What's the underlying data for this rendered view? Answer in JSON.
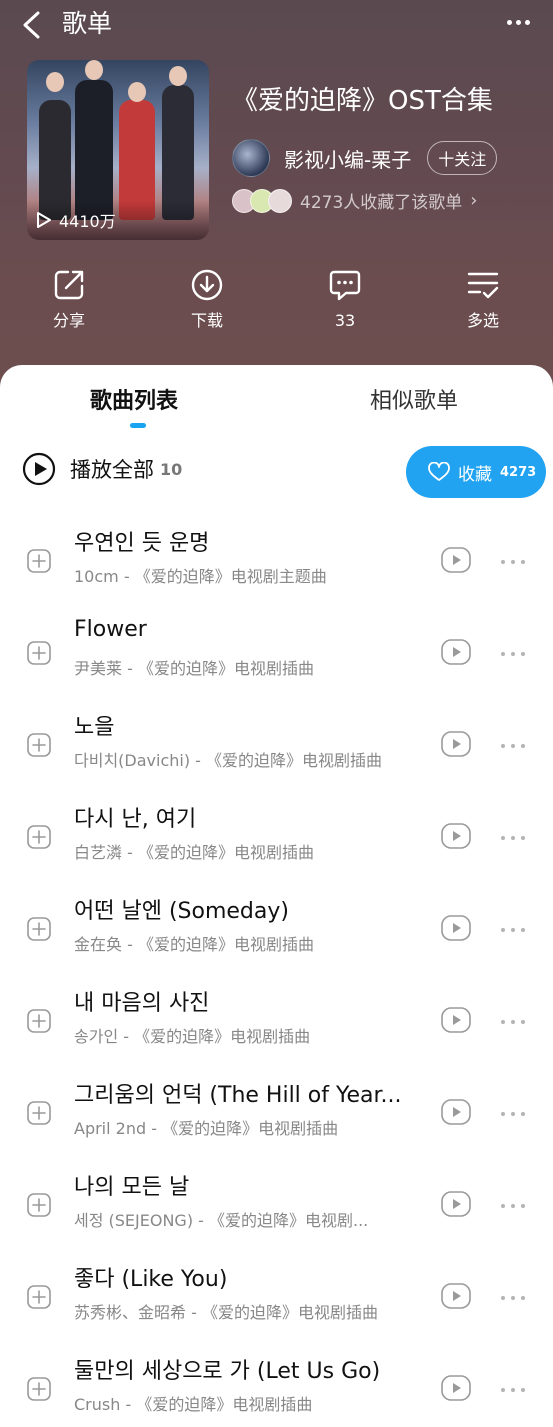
{
  "topbar": {
    "title": "歌单"
  },
  "playlist": {
    "title": "《爱的迫降》OST合集",
    "play_count": "4410万",
    "creator": "影视小编-栗子",
    "follow_label": "十关注",
    "favorites_text": "4273人收藏了该歌单"
  },
  "actions": [
    {
      "label": "分享",
      "icon": "share-icon"
    },
    {
      "label": "下载",
      "icon": "download-icon"
    },
    {
      "label": "33",
      "icon": "comment-icon"
    },
    {
      "label": "多选",
      "icon": "multi-select-icon"
    }
  ],
  "tabs": [
    "歌曲列表",
    "相似歌单"
  ],
  "play_all": {
    "label": "播放全部",
    "count": "10"
  },
  "collect": {
    "label": "收藏",
    "count": "4273"
  },
  "songs": [
    {
      "title": "우연인 듯 운명",
      "subtitle": "10cm - 《爱的迫降》电视剧主题曲"
    },
    {
      "title": "Flower",
      "subtitle": "尹美莱 - 《爱的迫降》电视剧插曲"
    },
    {
      "title": "노을",
      "subtitle": "다비치(Davichi) - 《爱的迫降》电视剧插曲"
    },
    {
      "title": "다시 난, 여기",
      "subtitle": "白艺潾 - 《爱的迫降》电视剧插曲"
    },
    {
      "title": "어떤 날엔 (Someday)",
      "subtitle": "金在奂 - 《爱的迫降》电视剧插曲"
    },
    {
      "title": "내 마음의 사진",
      "subtitle": "송가인 - 《爱的迫降》电视剧插曲"
    },
    {
      "title": "그리움의 언덕 (The Hill of Year...",
      "subtitle": "April 2nd - 《爱的迫降》电视剧插曲"
    },
    {
      "title": "나의 모든 날",
      "subtitle": "세정 (SEJEONG) - 《爱的迫降》电视剧..."
    },
    {
      "title": "좋다 (Like You)",
      "subtitle": "苏秀彬、金昭希 - 《爱的迫降》电视剧插曲"
    },
    {
      "title": "둘만의 세상으로 가 (Let Us Go)",
      "subtitle": "Crush - 《爱的迫降》电视剧插曲"
    }
  ],
  "colors": {
    "accent": "#21a3f1",
    "header_bg": "#5f4b50"
  }
}
